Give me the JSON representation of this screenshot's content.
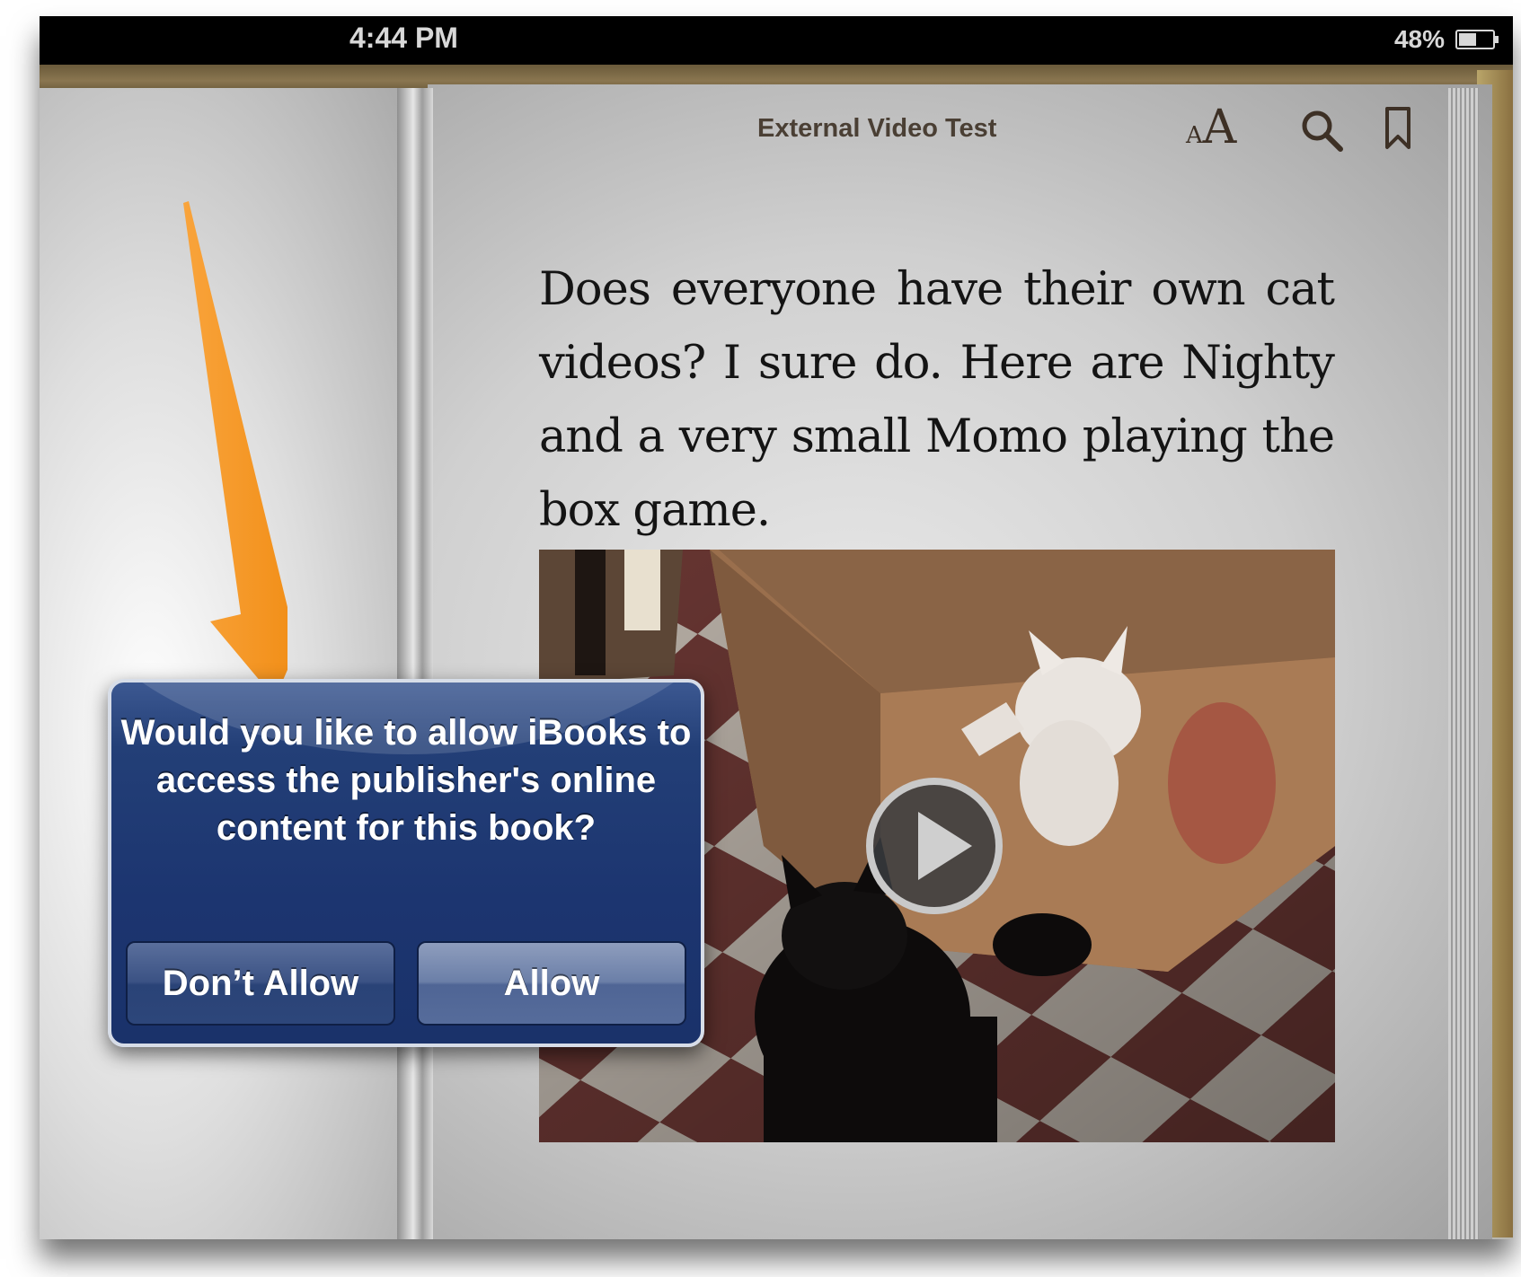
{
  "status_bar": {
    "time": "4:44 PM",
    "battery_percent": "48%",
    "battery_icon": "battery-icon"
  },
  "reader": {
    "book_title": "External Video Test",
    "toolbar": {
      "font_size_small": "A",
      "font_size_large": "A",
      "font_size_icon": "font-size-icon",
      "search_icon": "search-icon",
      "bookmark_icon": "bookmark-icon"
    },
    "body_text": "Does everyone have their own cat videos? I sure do. Here are Nighty and a very small Momo playing the box game.",
    "video": {
      "play_icon": "play-icon"
    }
  },
  "annotation": {
    "arrow_color": "#f7931e"
  },
  "alert": {
    "message": "Would you like to allow iBooks to access the publisher's online content for this book?",
    "buttons": {
      "dont_allow": "Don’t Allow",
      "allow": "Allow"
    }
  },
  "colors": {
    "alert_background": "#1c3570",
    "status_bar": "#000000",
    "title_text": "#4a3f34"
  }
}
